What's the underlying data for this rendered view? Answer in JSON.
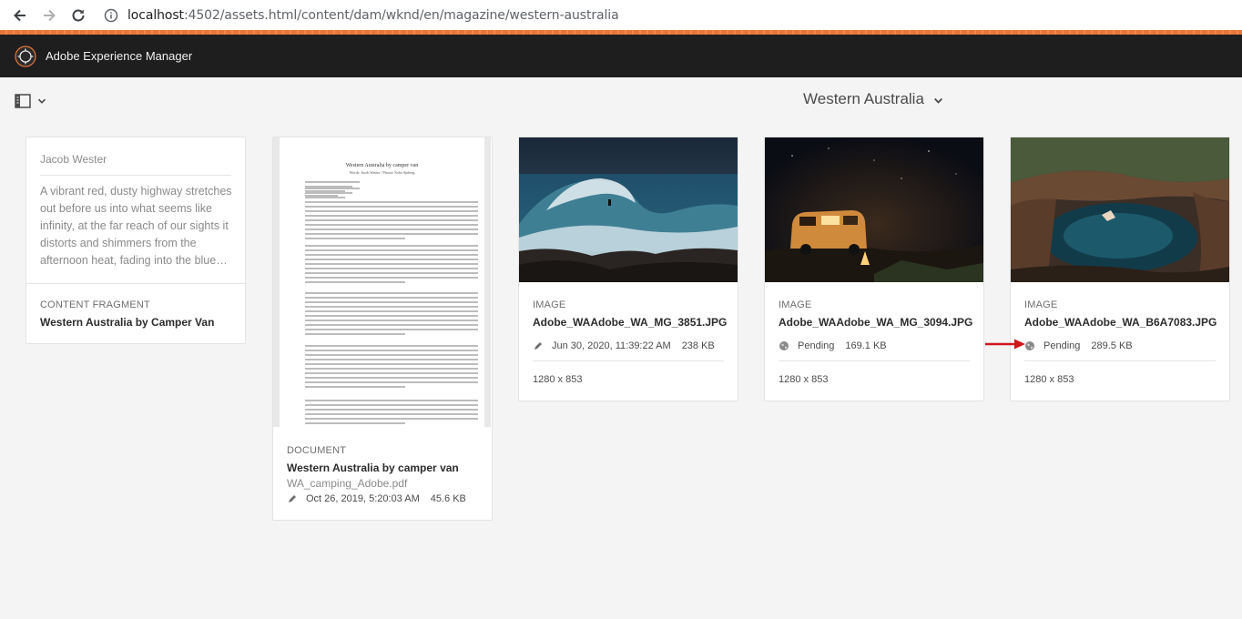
{
  "browser": {
    "url_host": "localhost",
    "url_rest": ":4502/assets.html/content/dam/wknd/en/magazine/western-australia"
  },
  "app": {
    "title": "Adobe Experience Manager"
  },
  "toolbar": {
    "folder_title": "Western Australia"
  },
  "cards": {
    "content_fragment": {
      "author": "Jacob Wester",
      "excerpt": "A vibrant red, dusty highway stretches out before us into what seems like infinity, at the far reach of our sights it distorts and shimmers from the afternoon heat, fading into the blue…",
      "type": "CONTENT FRAGMENT",
      "title": "Western Australia by Camper Van"
    },
    "document": {
      "page_title": "Western Australia by camper van",
      "page_sub": "Words: Jacob Wester / Photos: Sofia Sjöberg",
      "type": "DOCUMENT",
      "title": "Western Australia by camper van",
      "filename": "WA_camping_Adobe.pdf",
      "date": "Oct 26, 2019, 5:20:03 AM",
      "size": "45.6 KB"
    },
    "image1": {
      "type": "IMAGE",
      "title": "Adobe_WAAdobe_WA_MG_3851.JPG",
      "date": "Jun 30, 2020, 11:39:22 AM",
      "size": "238 KB",
      "dims": "1280 x 853"
    },
    "image2": {
      "type": "IMAGE",
      "title": "Adobe_WAAdobe_WA_MG_3094.JPG",
      "status": "Pending",
      "size": "169.1 KB",
      "dims": "1280 x 853"
    },
    "image3": {
      "type": "IMAGE",
      "title": "Adobe_WAAdobe_WA_B6A7083.JPG",
      "status": "Pending",
      "size": "289.5 KB",
      "dims": "1280 x 853"
    }
  },
  "colors": {
    "accent": "#e8763c",
    "header_bg": "#1e1e1e",
    "arrow": "#d0161b"
  }
}
